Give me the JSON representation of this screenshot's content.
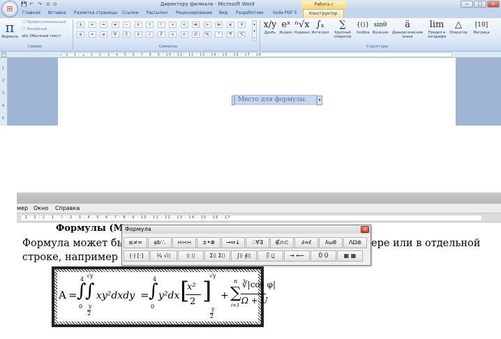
{
  "word": {
    "window_title": "Директору филмала - Microsoft Word",
    "context_title": "Работа с формулами",
    "office_button": "⊞",
    "qat_items": [
      "💾",
      "↶",
      "↷",
      "⊙",
      "⊙"
    ],
    "window_controls": [
      "−",
      "□",
      "×"
    ],
    "tabs": [
      "Главная",
      "Вставка",
      "Разметка страницы",
      "Ссылки",
      "Рассылки",
      "Рецензирование",
      "Вид",
      "Разработчик",
      "Soda PDF 5",
      "Конструктор"
    ],
    "active_tab": "Конструктор",
    "service": {
      "formula_glyph": "π",
      "formula_label": "Формула",
      "options": [
        "Профессиональный",
        "Линейный",
        "abc Обычный текст"
      ],
      "group_label": "Сервис"
    },
    "symbols": {
      "row1": [
        "±",
        "∞",
        "=",
        "≠",
        "~",
        "×",
        "÷",
        "!",
        "∝",
        "<",
        "≪",
        ">",
        "≫",
        "≤",
        "∓"
      ],
      "row2": [
        "≅",
        "≈",
        "≡",
        "∀",
        "∁",
        "∂",
        "√",
        "∛",
        "∪",
        "∩",
        "∅",
        "%",
        "°",
        "℉",
        "℃"
      ],
      "group_label": "Символы"
    },
    "structures": {
      "items": [
        {
          "glyph": "x/y",
          "label": "Дробь"
        },
        {
          "glyph": "eˣ",
          "label": "Индекс"
        },
        {
          "glyph": "ⁿ√x",
          "label": "Радикал"
        },
        {
          "glyph": "∫ₓ",
          "label": "Интеграл"
        },
        {
          "glyph": "∑",
          "label": "Крупный оператор"
        },
        {
          "glyph": "{()}",
          "label": "Скобка"
        },
        {
          "glyph": "sinθ",
          "label": "Функция"
        },
        {
          "glyph": "ä",
          "label": "Диакритические знаки"
        },
        {
          "glyph": "lim",
          "label": "Предел и логарифм"
        },
        {
          "glyph": "△",
          "label": "Оператор"
        },
        {
          "glyph": "[10]",
          "label": "Матрица"
        }
      ],
      "group_label": "Структуры"
    },
    "ruler_text": "· 2 · 1 · ⌂ · 1 · 2 · 3 · 4 · 5 · 6 · 7 · 8 · 9 · 10 · 11 · 12 · 13 · 14 · 15 · 16 · 17 · 18",
    "vruler_nums": [
      "1",
      "2",
      "3",
      "4",
      "5"
    ],
    "placeholder_text": "Место для формулы.",
    "placeholder_drop": "▾"
  },
  "editor2": {
    "menus": [
      "мер",
      "Окно",
      "Справка"
    ],
    "ruler_text": "· 1 · 2 · 1 · 1 · ▽ · 2 · 3 · 4 · 5 · 6 · 7 · 8 · 9 · 10 · 11 · 12 · 13 · 14 · 15 · 16 · 17",
    "heading": "Формулы (М",
    "line1_left": "Формула может быт",
    "line1_right": "ере или в отдельной",
    "line2": "строке, например",
    "palette": {
      "title": "Формула",
      "close": "×",
      "row1": [
        "≤≠≈",
        "ạb∵.",
        "∺∺∺",
        "±•⊗",
        "→⇔↓",
        "∴∀∃",
        "∉∩⊂",
        "∂∞ℓ",
        "λωθ",
        "ΛΩ⊛"
      ],
      "row2": [
        "(·) [·]",
        "⅓ √⌷",
        "⌷̇ ⌷̣",
        "Σ⌷ Σ⌷",
        "∫⌷ ∮⌷",
        "⌷̅ ⌷̲",
        "→ ⟵",
        "Ů Ű",
        "▦ ▦"
      ]
    },
    "formula": {
      "A": "A",
      "eq1": "=",
      "int1": "∫",
      "int1_up": "4",
      "int1_lo": "0",
      "int2": "∫",
      "int2_up": "√y",
      "int2_lo_num": "y",
      "int2_lo_den": "2",
      "body1": "xy²dxdy",
      "eq2": "=",
      "int3": "∫",
      "int3_up": "4",
      "int3_lo": "0",
      "body2": "y²dx",
      "frac_num": "x²",
      "frac_den": "2",
      "br_up": "√y",
      "br_lo_num": "y",
      "br_lo_den": "2",
      "plus": "+",
      "sum": "∑",
      "sum_up": "n",
      "sum_lo": "i=1",
      "num2": "∛|cos φ|",
      "den2": "Ω + U",
      "lbr": "[",
      "rbr": "]"
    }
  }
}
